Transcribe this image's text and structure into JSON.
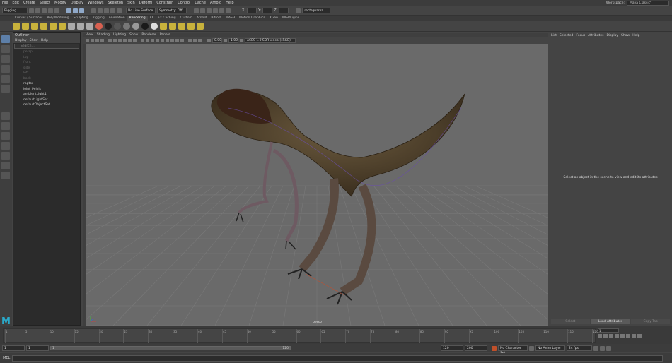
{
  "menubar": {
    "items": [
      "File",
      "Edit",
      "Create",
      "Select",
      "Modify",
      "Display",
      "Windows",
      "Skeleton",
      "Skin",
      "Deform",
      "Constrain",
      "Control",
      "Cache",
      "Arnold",
      "Help"
    ],
    "workspace_label": "Workspace:",
    "workspace_value": "Maya Classic*"
  },
  "status": {
    "menuset": "Rigging",
    "live_surface": "No Live Surface",
    "symmetry": "Symmetry: Off",
    "x_label": "X:",
    "y_label": "Y:",
    "z_label": "Z:",
    "renderer": "rectsquarez"
  },
  "shelf_tabs": [
    "Curves / Surfaces",
    "Poly Modeling",
    "Sculpting",
    "Rigging",
    "Animation",
    "Rendering",
    "FX",
    "FX Caching",
    "Custom",
    "Arnold",
    "Bifrost",
    "MASH",
    "Motion Graphics",
    "XGen",
    "MISPlugins"
  ],
  "shelf_active": "Rendering",
  "outliner": {
    "title": "Outliner",
    "menu": [
      "Display",
      "Show",
      "Help"
    ],
    "search_placeholder": "Search...",
    "items": [
      {
        "label": "persp",
        "dim": true
      },
      {
        "label": "top",
        "dim": true
      },
      {
        "label": "front",
        "dim": true
      },
      {
        "label": "side",
        "dim": true
      },
      {
        "label": "left",
        "dim": true
      },
      {
        "label": "back",
        "dim": true
      },
      {
        "label": "raptor",
        "dim": false
      },
      {
        "label": "joint_Pelvis",
        "dim": false
      },
      {
        "label": "ambientLight1",
        "dim": false
      },
      {
        "label": "defaultLightSet",
        "dim": false
      },
      {
        "label": "defaultObjectSet",
        "dim": false
      }
    ]
  },
  "viewport": {
    "menu": [
      "View",
      "Shading",
      "Lighting",
      "Show",
      "Renderer",
      "Panels"
    ],
    "exposure": "0.00",
    "gamma": "1.00",
    "color_space": "ACES 1.0 SDR-video (sRGB)",
    "camera_label": "persp"
  },
  "attribute_editor": {
    "menu": [
      "List",
      "Selected",
      "Focus",
      "Attributes",
      "Display",
      "Show",
      "Help"
    ],
    "message": "Select an object in the scene to view and edit its attributes",
    "buttons": [
      "Select",
      "Load Attributes",
      "Copy Tab"
    ]
  },
  "timeline": {
    "tick_labels": [
      "1",
      "5",
      "10",
      "15",
      "20",
      "25",
      "30",
      "35",
      "40",
      "45",
      "50",
      "55",
      "60",
      "65",
      "70",
      "75",
      "80",
      "85",
      "90",
      "95",
      "100",
      "105",
      "110",
      "115",
      "120"
    ],
    "current_frame": "1"
  },
  "range": {
    "start": "1",
    "anim_start": "1",
    "slider_start": "1",
    "slider_end": "120",
    "anim_end": "120",
    "end": "200",
    "character_set": "No Character Set",
    "anim_layer": "No Anim Layer",
    "fps": "24 fps"
  },
  "command": {
    "label": "MEL"
  }
}
